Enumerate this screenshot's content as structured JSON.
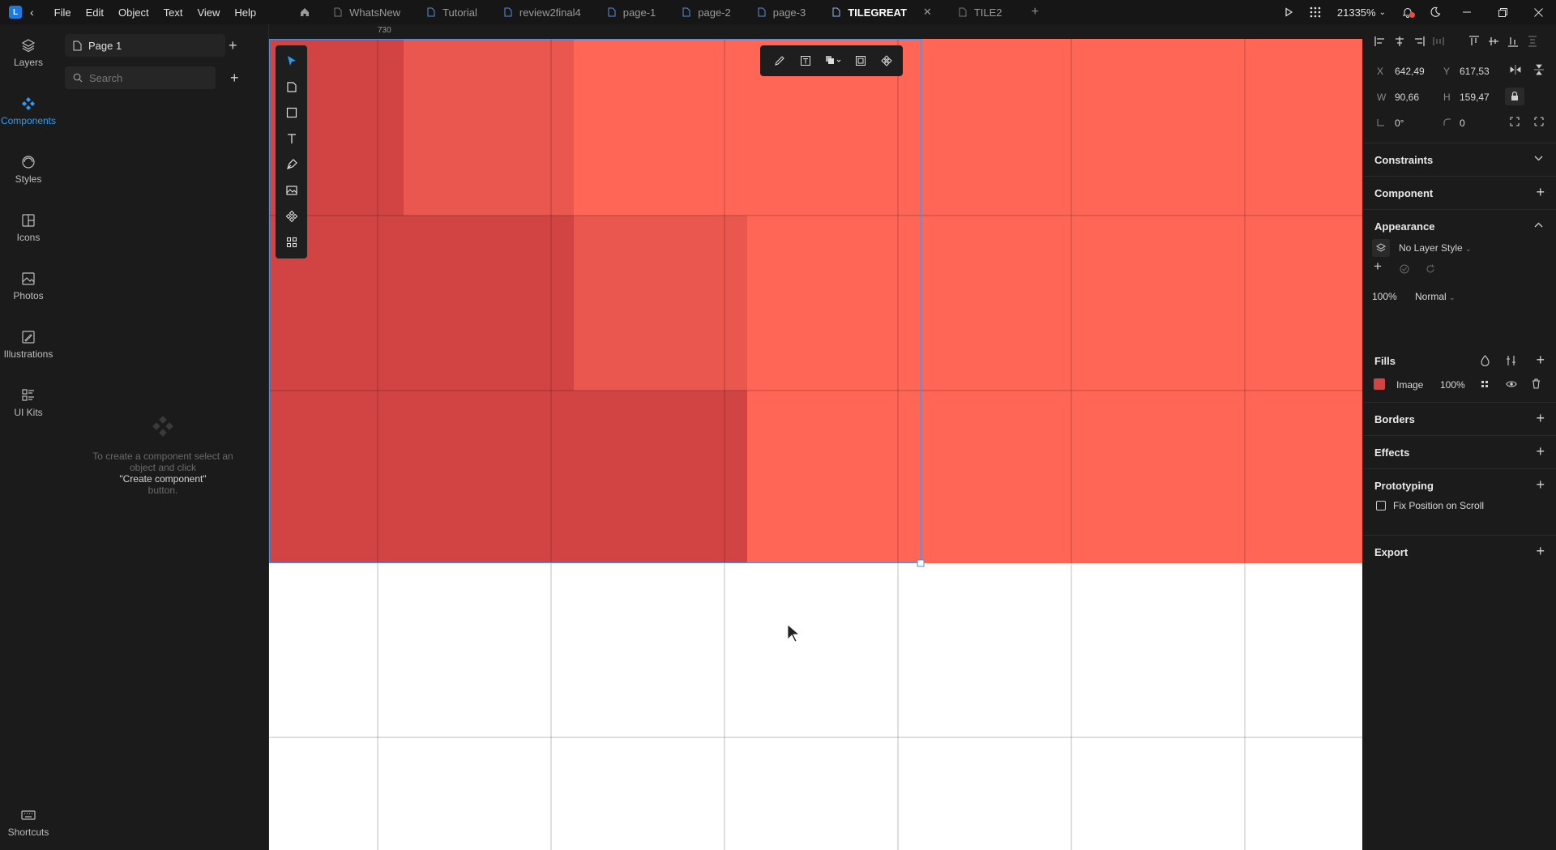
{
  "menu": [
    "File",
    "Edit",
    "Object",
    "Text",
    "View",
    "Help"
  ],
  "tabs": [
    {
      "label": "WhatsNew",
      "active": false
    },
    {
      "label": "Tutorial",
      "active": false
    },
    {
      "label": "review2final4",
      "active": false
    },
    {
      "label": "page-1",
      "active": false
    },
    {
      "label": "page-2",
      "active": false
    },
    {
      "label": "page-3",
      "active": false
    },
    {
      "label": "TILEGREAT",
      "active": true
    },
    {
      "label": "TILE2",
      "active": false
    }
  ],
  "zoom": "21335%",
  "rail": [
    {
      "label": "Layers",
      "icon": "layers-icon",
      "active": false
    },
    {
      "label": "Components",
      "icon": "components-icon",
      "active": true
    },
    {
      "label": "Styles",
      "icon": "styles-icon",
      "active": false
    },
    {
      "label": "Icons",
      "icon": "icons-icon",
      "active": false
    },
    {
      "label": "Photos",
      "icon": "photos-icon",
      "active": false
    },
    {
      "label": "Illustrations",
      "icon": "illustrations-icon",
      "active": false
    },
    {
      "label": "UI Kits",
      "icon": "ui-kits-icon",
      "active": false
    }
  ],
  "shortcuts_label": "Shortcuts",
  "page": {
    "name": "Page 1"
  },
  "search": {
    "placeholder": "Search"
  },
  "empty": {
    "line1": "To create a component select an",
    "line2": "object and click",
    "cmd": "\"Create component\"",
    "line3": "button."
  },
  "ruler": {
    "mark": "730"
  },
  "props": {
    "x_label": "X",
    "x": "642,49",
    "y_label": "Y",
    "y": "617,53",
    "w_label": "W",
    "w": "90,66",
    "h_label": "H",
    "h": "159,47",
    "rotation": "0°",
    "radius": "0"
  },
  "sections": {
    "constraints": "Constraints",
    "component": "Component",
    "appearance": "Appearance",
    "layer_style": "No Layer Style",
    "opacity": "100%",
    "blend": "Normal",
    "fills": "Fills",
    "fill_type": "Image",
    "fill_opacity": "100%",
    "borders": "Borders",
    "effects": "Effects",
    "prototyping": "Prototyping",
    "fix_position": "Fix Position on Scroll",
    "export": "Export"
  },
  "colors": {
    "accent": "#2d9cf5",
    "tile_light": "#ff6656",
    "tile_mid": "#e9574e",
    "tile_dark": "#d24444",
    "selection": "#4a90e2"
  }
}
